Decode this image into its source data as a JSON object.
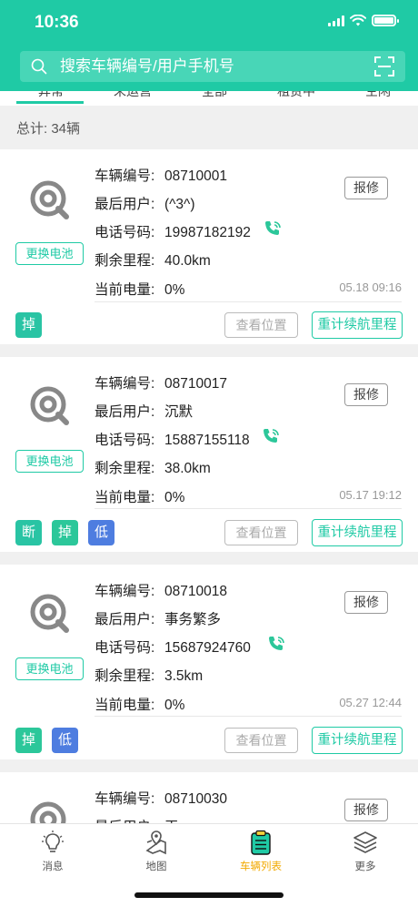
{
  "status_bar": {
    "time": "10:36"
  },
  "search": {
    "placeholder": "搜索车辆编号/用户手机号"
  },
  "tabs": [
    {
      "label": "异常"
    },
    {
      "label": "未运营"
    },
    {
      "label": "全部"
    },
    {
      "label": "租赁中"
    },
    {
      "label": "空闲"
    }
  ],
  "summary": {
    "total": "总计: 34辆"
  },
  "labels": {
    "vehicle_no": "车辆编号:",
    "last_user": "最后用户:",
    "phone": "电话号码:",
    "mileage": "剩余里程:",
    "battery": "当前电量:",
    "replace_battery": "更换电池",
    "report": "报修",
    "view_location": "查看位置",
    "recalc_range": "重计续航里程"
  },
  "vehicles": [
    {
      "vehicle_no": "08710001",
      "last_user": "(^3^)",
      "phone": "19987182192",
      "mileage": "40.0km",
      "battery": "0%",
      "time": "05.18 09:16",
      "tags": [
        "掉"
      ]
    },
    {
      "vehicle_no": "08710017",
      "last_user": "沉默",
      "phone": "15887155118",
      "mileage": "38.0km",
      "battery": "0%",
      "time": "05.17 19:12",
      "tags": [
        "断",
        "掉",
        "低"
      ]
    },
    {
      "vehicle_no": "08710018",
      "last_user": "事务繁多",
      "phone": "15687924760",
      "mileage": "3.5km",
      "battery": "0%",
      "time": "05.27 12:44",
      "tags": [
        "掉",
        "低"
      ]
    },
    {
      "vehicle_no": "08710030",
      "last_user": "王",
      "phone": "",
      "mileage": "",
      "battery": "",
      "time": "",
      "tags": []
    }
  ],
  "bottom_nav": [
    {
      "label": "消息",
      "icon": "bulb-icon"
    },
    {
      "label": "地图",
      "icon": "map-icon"
    },
    {
      "label": "车辆列表",
      "icon": "clipboard-icon"
    },
    {
      "label": "更多",
      "icon": "layers-icon"
    }
  ],
  "colors": {
    "primary": "#1fcaa5",
    "active_nav": "#f2a900",
    "tag_green": "#2cc79a",
    "tag_blue": "#4e7de0"
  }
}
